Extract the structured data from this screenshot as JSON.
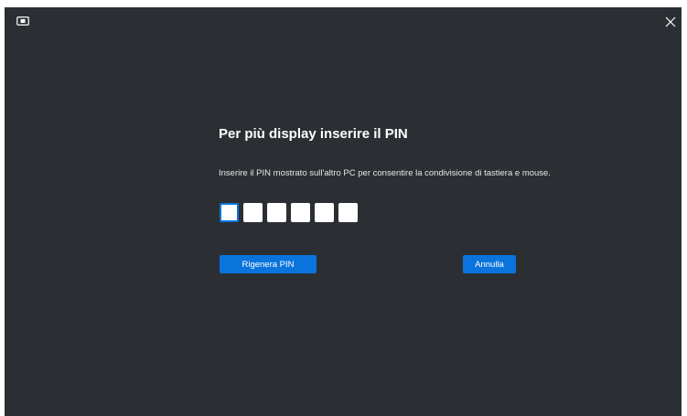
{
  "window": {
    "app_icon": "display-monitor-icon",
    "close_icon": "close-icon"
  },
  "dialog": {
    "title": "Per più display inserire il PIN",
    "description": "Inserire il PIN mostrato sull'altro PC per consentire la condivisione di tastiera e mouse.",
    "pin_digits": [
      "",
      "",
      "",
      "",
      "",
      ""
    ],
    "regenerate_label": "Rigenera PIN",
    "cancel_label": "Annulla"
  },
  "colors": {
    "background": "#2b2f34",
    "accent": "#0a74dc",
    "text": "#ffffff"
  }
}
